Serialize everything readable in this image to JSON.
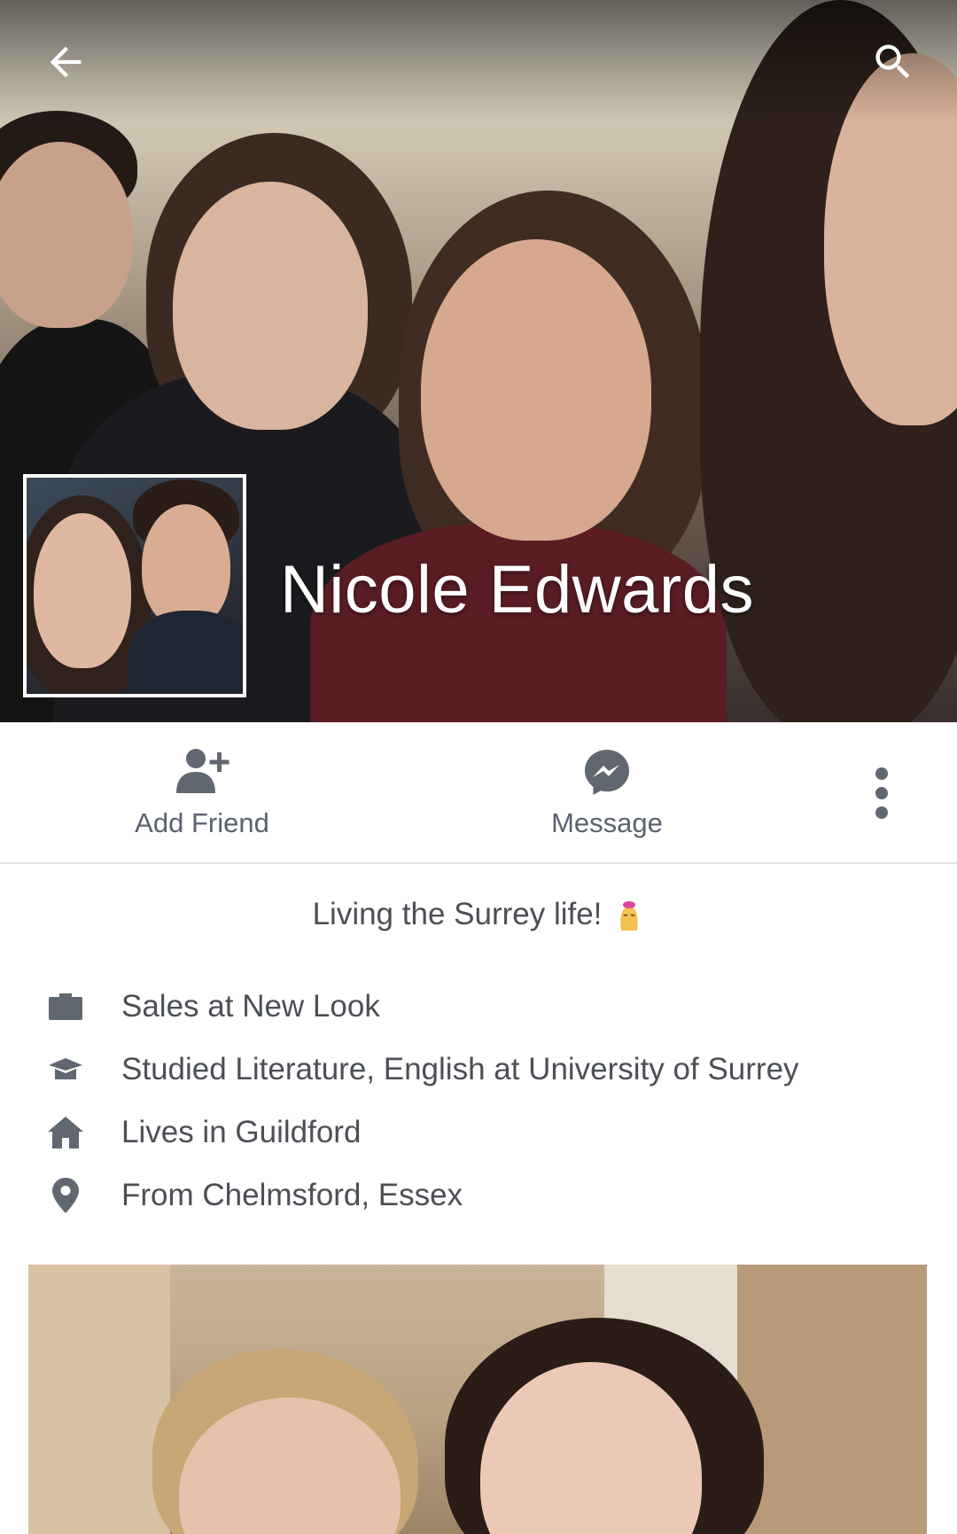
{
  "header": {
    "back_icon": "arrow-left-icon",
    "search_icon": "search-icon"
  },
  "profile": {
    "name": "Nicole Edwards"
  },
  "actions": {
    "add_friend": {
      "label": "Add Friend",
      "icon": "add-friend-icon"
    },
    "message": {
      "label": "Message",
      "icon": "messenger-icon"
    },
    "more": {
      "icon": "more-vertical-icon"
    }
  },
  "bio": {
    "text": "Living the Surrey life!",
    "emoji": "emoji-icon"
  },
  "intro": {
    "items": [
      {
        "icon": "briefcase-icon",
        "text": "Sales at New Look"
      },
      {
        "icon": "graduation-cap-icon",
        "text": "Studied Literature, English at University of Surrey"
      },
      {
        "icon": "home-icon",
        "text": "Lives in Guildford"
      },
      {
        "icon": "location-pin-icon",
        "text": "From Chelmsford, Essex"
      }
    ]
  },
  "colors": {
    "icon_gray": "#616770",
    "text_gray": "#4b4f56",
    "label_gray": "#5b6270",
    "divider": "#e2e3e6"
  }
}
